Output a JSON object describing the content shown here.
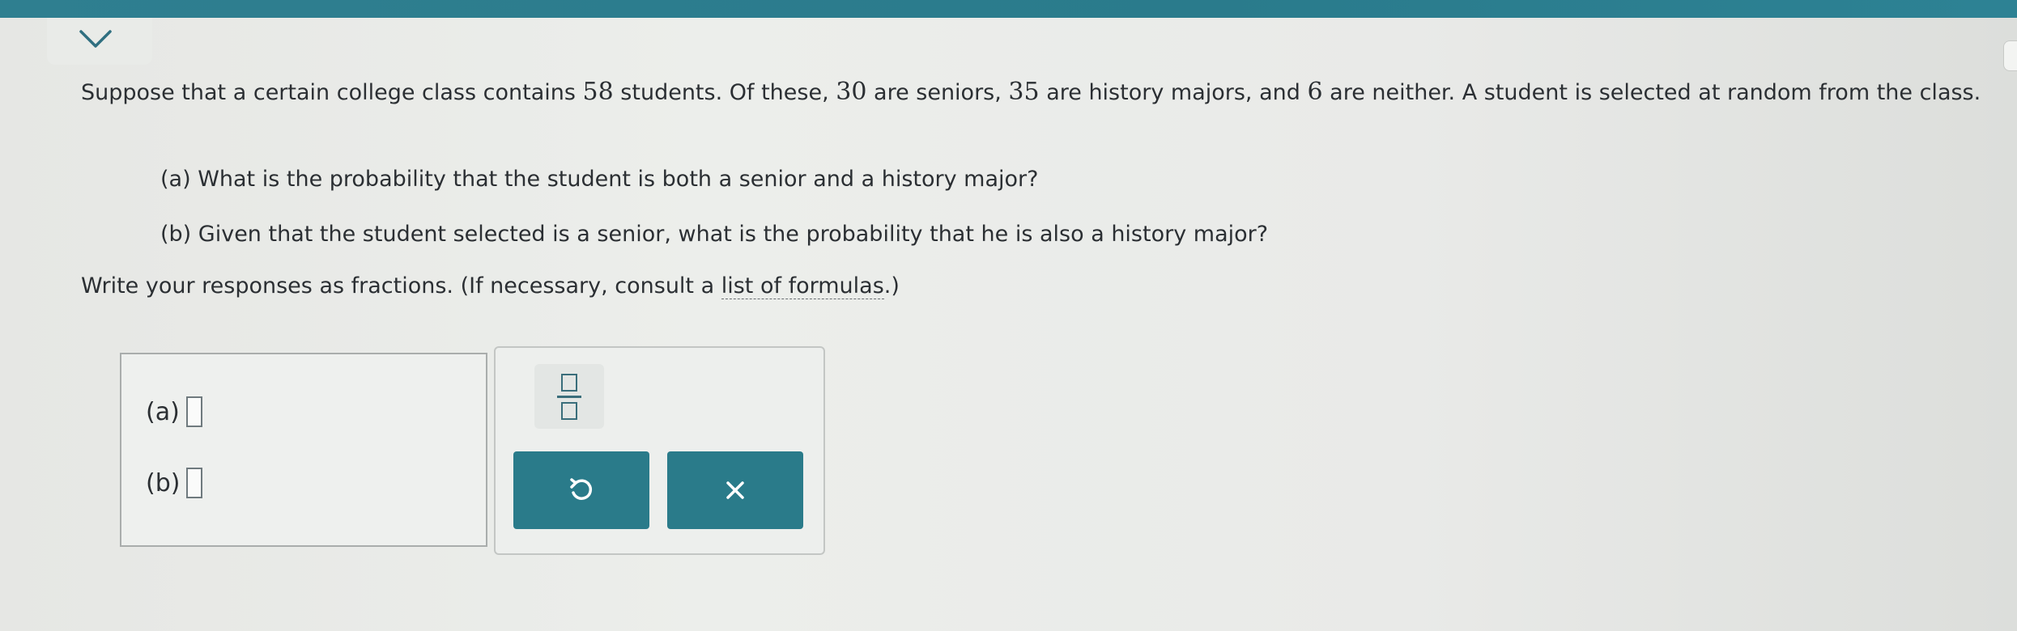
{
  "colors": {
    "top_bar": "#2a7b8c",
    "button_teal": "#2a7b8a",
    "text": "#2b2f33"
  },
  "header": {
    "collapse_icon": "chevron-down-icon"
  },
  "problem": {
    "part1": "Suppose that a certain college class contains ",
    "n_students": "58",
    "part2": " students. Of these, ",
    "n_seniors": "30",
    "part3": " are seniors, ",
    "n_history": "35",
    "part4": " are history majors, and ",
    "n_neither": "6",
    "part5": " are neither. A student is selected at random from the class."
  },
  "questions": {
    "a": "(a) What is the probability that the student is both a senior and a history major?",
    "b": "(b) Given that the student selected is a senior, what is the probability that he is also a history major?"
  },
  "instructions": {
    "before_link": "Write your responses as fractions. (If necessary, consult a ",
    "link_text": "list of formulas",
    "after_link": ".)"
  },
  "answers": {
    "a_label": "(a)",
    "a_value": "",
    "b_label": "(b)",
    "b_value": ""
  },
  "toolbar": {
    "fraction_icon": "fraction-icon",
    "undo_icon": "undo-icon",
    "clear_icon": "close-icon"
  }
}
